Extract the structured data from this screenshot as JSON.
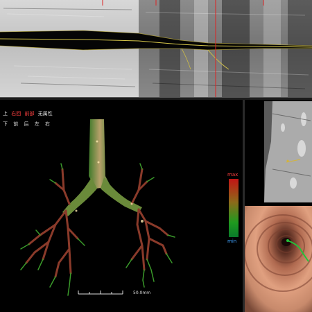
{
  "legend": {
    "row1": [
      {
        "text": "上",
        "color": "#e0e0e0"
      },
      {
        "text": "右回",
        "color": "#ff4040"
      },
      {
        "text": "前部",
        "color": "#ff4040"
      },
      {
        "text": "无属性",
        "color": "#e0e0e0"
      }
    ],
    "row2": [
      "下",
      "前",
      "后",
      "左",
      "右"
    ]
  },
  "colorbar": {
    "max_label": "max",
    "min_label": "min",
    "colors": [
      "#c21515",
      "#1f9a1f"
    ]
  },
  "scale": {
    "label": "50.0mm"
  },
  "icons": {
    "airway_tree": "bronchial-tree-3d",
    "slice": "ct-slice",
    "endoscopy": "virtual-bronchoscopy"
  }
}
